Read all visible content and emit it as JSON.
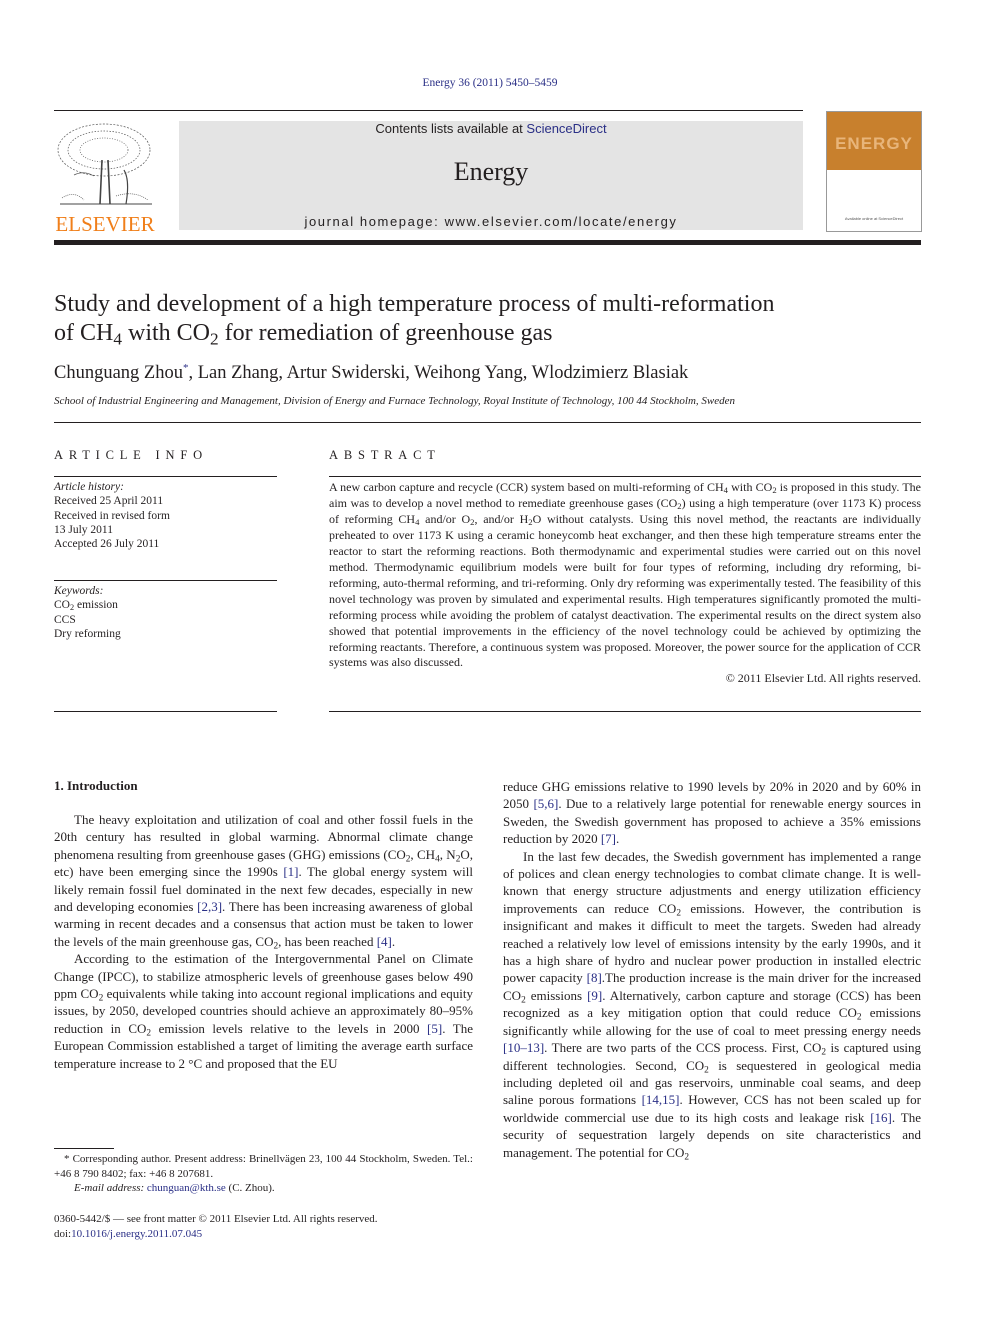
{
  "header": {
    "citation": "Energy 36 (2011) 5450–5459",
    "contents_prefix": "Contents lists available at ",
    "sciencedirect_link": "ScienceDirect",
    "journal_name": "Energy",
    "homepage_prefix": "journal homepage: ",
    "homepage_url": "www.elsevier.com/locate/energy",
    "publisher_logo_text": "ELSEVIER",
    "cover_title": "ENERGY",
    "cover_bottom_text": "Available online at ScienceDirect",
    "colors": {
      "link": "#2a2f86",
      "elsevier_orange": "#f07f1a",
      "cover_orange": "#c8802d",
      "banner_gray": "#e4e4e4"
    }
  },
  "article": {
    "title_line1": "Study and development of a high temperature process of multi-reformation",
    "title_line2_parts": [
      "of CH",
      "4",
      " with CO",
      "2",
      " for remediation of greenhouse gas"
    ],
    "first_author": "Chunguang Zhou",
    "first_author_mark": "*",
    "other_authors": ", Lan Zhang, Artur Swiderski, Weihong Yang, Wlodzimierz Blasiak",
    "affiliation": "School of Industrial Engineering and Management, Division of Energy and Furnace Technology, Royal Institute of Technology, 100 44 Stockholm, Sweden"
  },
  "article_info": {
    "heading": "ARTICLE INFO",
    "history_label": "Article history:",
    "history": [
      "Received 25 April 2011",
      "Received in revised form",
      "13 July 2011",
      "Accepted 26 July 2011"
    ],
    "keywords_label": "Keywords:",
    "keyword1_parts": [
      "CO",
      "2",
      " emission"
    ],
    "keyword2": "CCS",
    "keyword3": "Dry reforming"
  },
  "abstract": {
    "heading": "ABSTRACT",
    "p1": "A new carbon capture and recycle (CCR) system based on multi-reforming of CH",
    "p2": " with CO",
    "p3": " is proposed in this study. The aim was to develop a novel method to remediate greenhouse gases (CO",
    "p4": ") using a high temperature (over 1173 K) process of reforming CH",
    "p5": " and/or O",
    "p6": ", and/or H",
    "p7": "O without catalysts. Using this novel method, the reactants are individually preheated to over 1173 K using a ceramic honeycomb heat exchanger, and then these high temperature streams enter the reactor to start the reforming reactions. Both thermodynamic and experimental studies were carried out on this novel method. Thermodynamic equilibrium models were built for four types of reforming, including dry reforming, bi-reforming, auto-thermal reforming, and tri-reforming. Only dry reforming was experimentally tested. The feasibility of this novel technology was proven by simulated and experimental results. High temperatures significantly promoted the multi-reforming process while avoiding the problem of catalyst deactivation. The experimental results on the direct system also showed that potential improvements in the efficiency of the novel technology could be achieved by optimizing the reforming reactants. Therefore, a continuous system was proposed. Moreover, the power source for the application of CCR systems was also discussed.",
    "sub4": "4",
    "sub2": "2",
    "copyright": "© 2011 Elsevier Ltd. All rights reserved."
  },
  "introduction": {
    "heading": "1.  Introduction",
    "para1": {
      "a": "The heavy exploitation and utilization of coal and other fossil fuels in the 20th century has resulted in global warming. Abnormal climate change phenomena resulting from greenhouse gases (GHG) emissions (CO",
      "b": ", CH",
      "c": ", N",
      "d": "O, etc) have been emerging since the 1990s ",
      "ref1": "[1]",
      "e": ". The global energy system will likely remain fossil fuel dominated in the next few decades, especially in new and developing economies ",
      "ref2": "[2,3]",
      "f": ". There has been increasing awareness of global warming in recent decades and a consensus that action must be taken to lower the levels of the main greenhouse gas, CO",
      "g": ", has been reached ",
      "ref3": "[4]",
      "h": "."
    },
    "para2": {
      "a": "According to the estimation of the Intergovernmental Panel on Climate Change (IPCC), to stabilize atmospheric levels of greenhouse gases below 490 ppm CO",
      "b": " equivalents while taking into account regional implications and equity issues, by 2050, developed countries should achieve an approximately 80–95% reduction in CO",
      "c": " emission levels relative to the levels in 2000 ",
      "ref1": "[5]",
      "d": ". The European Commission established a target of limiting the average earth surface temperature increase to 2 °C and proposed that the EU reduce GHG emissions relative to 1990 levels by 20% in 2020 and by 60% in 2050 ",
      "ref2": "[5,6]",
      "e": ". Due to a relatively large potential for renewable energy sources in Sweden, the Swedish government has proposed to achieve a 35% emissions reduction by 2020 ",
      "ref3": "[7]",
      "f": "."
    },
    "para3": {
      "a": "In the last few decades, the Swedish government has implemented a range of polices and clean energy technologies to combat climate change. It is well-known that energy structure adjustments and energy utilization efficiency improvements can reduce CO",
      "b": " emissions. However, the contribution is insignificant and makes it difficult to meet the targets. Sweden had already reached a relatively low level of emissions intensity by the early 1990s, and it has a high share of hydro and nuclear power production in installed electric power capacity ",
      "ref1": "[8]",
      "c": ".The production increase is the main driver for the increased CO",
      "d": " emissions ",
      "ref2": "[9]",
      "e": ". Alternatively, carbon capture and storage (CCS) has been recognized as a key mitigation option that could reduce CO",
      "f": " emissions significantly while allowing for the use of coal to meet pressing energy needs ",
      "ref3": "[10–13]",
      "g": ". There are two parts of the CCS process. First, CO",
      "h": " is captured using different technologies. Second, CO",
      "i": " is sequestered in geological media including depleted oil and gas reservoirs, unminable coal seams, and deep saline porous formations ",
      "ref4": "[14,15]",
      "j": ". However, CCS has not been scaled up for worldwide commercial use due to its high costs and leakage risk ",
      "ref5": "[16]",
      "k": ". The security of sequestration largely depends on site characteristics and management. The potential for CO",
      "sub2": "2",
      "sub4": "4"
    }
  },
  "footnote": {
    "star_text": "* Corresponding author. Present address: Brinellvägen 23, 100 44 Stockholm, Sweden. Tel.: +46 8 790 8402; fax: +46 8 207681.",
    "email_label": "E-mail address: ",
    "email": "chunguan@kth.se",
    "email_suffix": " (C. Zhou).",
    "front_matter": "0360-5442/$ — see front matter © 2011 Elsevier Ltd. All rights reserved.",
    "doi_prefix": "doi:",
    "doi": "10.1016/j.energy.2011.07.045"
  }
}
